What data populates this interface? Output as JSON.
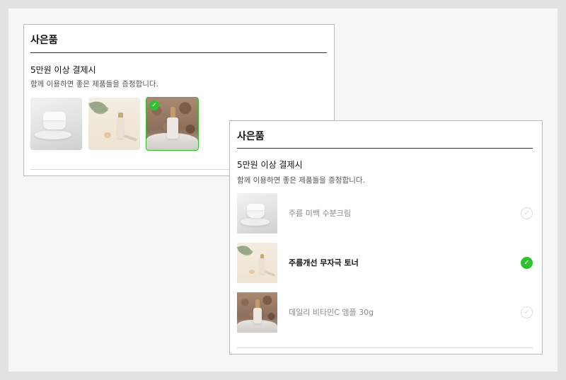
{
  "card_grid": {
    "title": "사은품",
    "subheading": "5만원 이상 결제시",
    "description": "함께 이용하면 좋은 제품들을 증정합니다.",
    "items": [
      {
        "image": "cream-jar",
        "selected": false
      },
      {
        "image": "toner-bottle",
        "selected": false
      },
      {
        "image": "ampoule-bottle",
        "selected": true
      }
    ]
  },
  "card_list": {
    "title": "사은품",
    "subheading": "5만원 이상 결제시",
    "description": "함께 이용하면 좋은 제품들을 증정합니다.",
    "items": [
      {
        "label": "주름 미백 수분크림",
        "image": "cream-jar",
        "selected": false
      },
      {
        "label": "주름개선 무자극 토너",
        "image": "toner-bottle",
        "selected": true
      },
      {
        "label": "데일리 비타민C 앰플 30g",
        "image": "ampoule-bottle",
        "selected": false
      }
    ]
  },
  "colors": {
    "accent": "#2fc12f",
    "background": "#f6f6f6",
    "border": "#b9b9b9"
  },
  "icons": {
    "check": "✓"
  }
}
